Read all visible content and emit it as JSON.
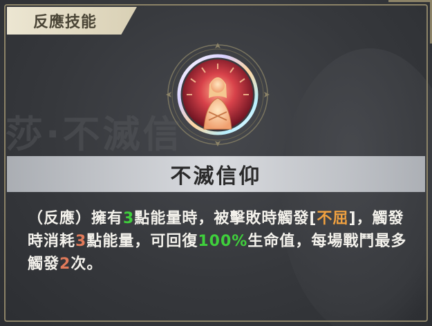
{
  "header": {
    "category_label": "反應技能"
  },
  "skill": {
    "name": "不滅信仰",
    "icon": "martyr-figure-icon",
    "description_parts": [
      {
        "text": "（反應）擁有",
        "style": "plain"
      },
      {
        "text": "3",
        "style": "num-green"
      },
      {
        "text": "點能量時，被擊敗時觸發",
        "style": "plain"
      },
      {
        "text": "[",
        "style": "plain"
      },
      {
        "text": "不",
        "style": "hl-orange"
      },
      {
        "text": "屈",
        "style": "hl-orange"
      },
      {
        "text": "]，觸發時消耗",
        "style": "plain"
      },
      {
        "text": "3",
        "style": "num-red"
      },
      {
        "text": "點能量，可回復",
        "style": "plain"
      },
      {
        "text": "100%",
        "style": "num-green"
      },
      {
        "text": "生命值，每場戰鬥最多觸發",
        "style": "plain"
      },
      {
        "text": "2",
        "style": "num-red"
      },
      {
        "text": "次。",
        "style": "plain"
      }
    ]
  },
  "background": {
    "watermark_text": "莎·不滅信"
  },
  "colors": {
    "highlight_red": "#e07a5a",
    "highlight_green": "#3fcf3c",
    "highlight_orange": "#f0a140",
    "tag_bg": "#ece6d2"
  }
}
